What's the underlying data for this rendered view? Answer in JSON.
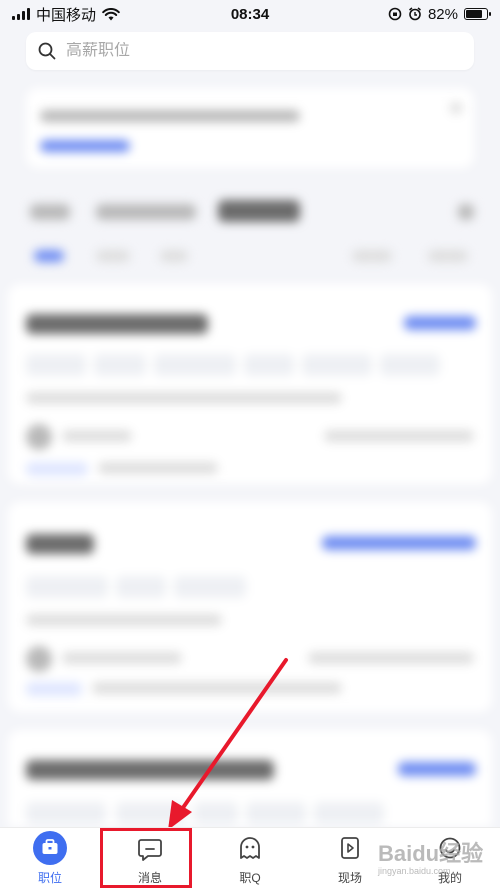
{
  "status_bar": {
    "carrier": "中国移动",
    "time": "08:34",
    "battery": "82%",
    "battery_level": 0.82
  },
  "search": {
    "placeholder": "高薪职位"
  },
  "bottom_nav": {
    "items": [
      {
        "label": "职位",
        "icon": "briefcase-icon",
        "active": true
      },
      {
        "label": "消息",
        "icon": "message-icon",
        "active": false
      },
      {
        "label": "职Q",
        "icon": "ghost-icon",
        "active": false
      },
      {
        "label": "现场",
        "icon": "video-icon",
        "active": false
      },
      {
        "label": "我的",
        "icon": "profile-icon",
        "active": false
      }
    ]
  },
  "watermark": {
    "brand": "Baidu经验",
    "url": "jingyan.baidu.com"
  },
  "colors": {
    "accent": "#3f6ef0",
    "annotation": "#e8192c",
    "background": "#f4f5f9"
  }
}
